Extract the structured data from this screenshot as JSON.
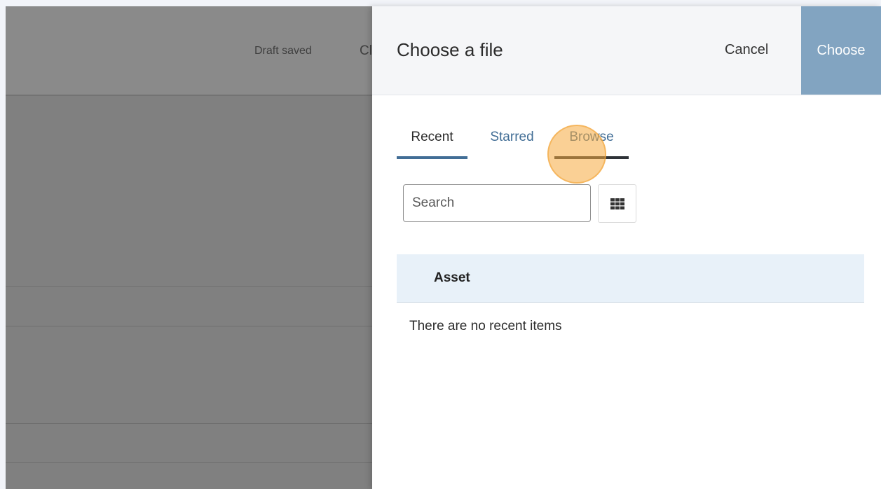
{
  "background_page": {
    "draft_status": "Draft saved",
    "partial_button": "Cl"
  },
  "drawer": {
    "title": "Choose a file",
    "cancel_label": "Cancel",
    "choose_label": "Choose",
    "tabs": [
      {
        "label": "Recent",
        "active": true
      },
      {
        "label": "Starred",
        "active": false
      },
      {
        "label": "Browse",
        "active": false
      }
    ],
    "search": {
      "placeholder": "Search",
      "value": ""
    },
    "view_toggle_icon": "grid-icon",
    "table": {
      "columns": [
        "Asset"
      ],
      "empty_message": "There are no recent items"
    }
  },
  "colors": {
    "accent": "#426e96",
    "choose_button": "#82a4c1",
    "table_header": "#e8f1f9",
    "click_highlight": "#f6aa3e"
  }
}
